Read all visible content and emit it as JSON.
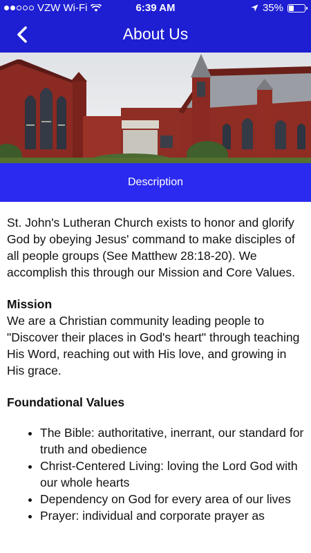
{
  "status_bar": {
    "carrier": "VZW Wi-Fi",
    "time": "6:39 AM",
    "battery": "35%",
    "battery_level": 0.35,
    "icons": [
      "signal-dots-icon",
      "wifi-icon",
      "location-arrow-icon",
      "battery-icon"
    ]
  },
  "nav": {
    "title": "About Us",
    "back_icon": "chevron-left-icon"
  },
  "hero": {
    "image": "church-photo"
  },
  "description_tab": {
    "label": "Description"
  },
  "content": {
    "intro": "St. John's Lutheran Church exists to honor and glorify God by obeying Jesus' command to make disciples of all people groups (See Matthew 28:18-20). We accomplish this through our Mission and Core Values.",
    "mission_heading": "Mission",
    "mission_text": "We are a Christian community leading people to \"Discover their places in God's heart\" through teaching His Word, reaching out with His love, and growing in His grace.",
    "values_heading": "Foundational Values",
    "values": [
      "The Bible: authoritative, inerrant, our standard for truth and obedience",
      "Christ-Centered Living: loving the Lord God with our whole hearts",
      "Dependency on God for every area of our lives",
      "Prayer: individual and corporate prayer as"
    ]
  },
  "colors": {
    "header_blue": "#1e1ed2",
    "tab_blue": "#2a2af0"
  }
}
